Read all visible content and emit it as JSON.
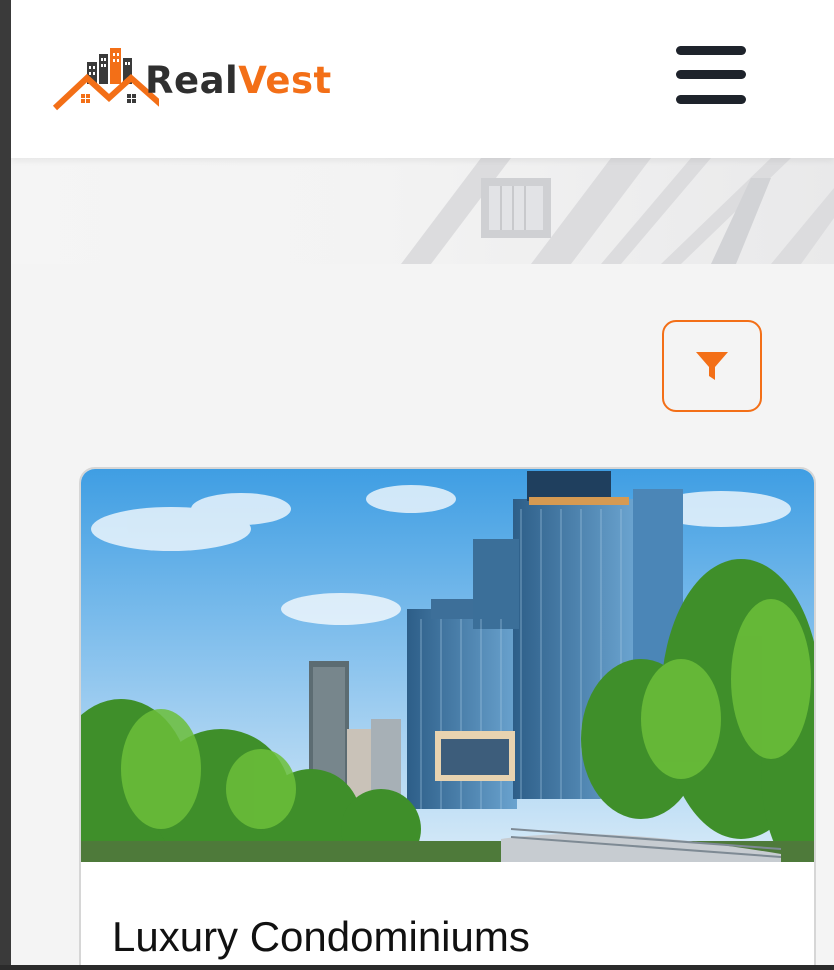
{
  "header": {
    "logo": {
      "part1": "Real",
      "part2": "Vest",
      "icon": "house-buildings-logo-icon"
    },
    "menu_icon": "hamburger-menu-icon"
  },
  "hero": {
    "image": "building-facade-image"
  },
  "filter": {
    "icon": "funnel-filter-icon"
  },
  "listing": {
    "image": "city-skyscrapers-park-image",
    "title": "Luxury Condominiums"
  },
  "colors": {
    "accent": "#f36f17",
    "dark": "#1e232b",
    "page_bg": "#f4f4f4",
    "card_border": "#d6d6d6"
  }
}
